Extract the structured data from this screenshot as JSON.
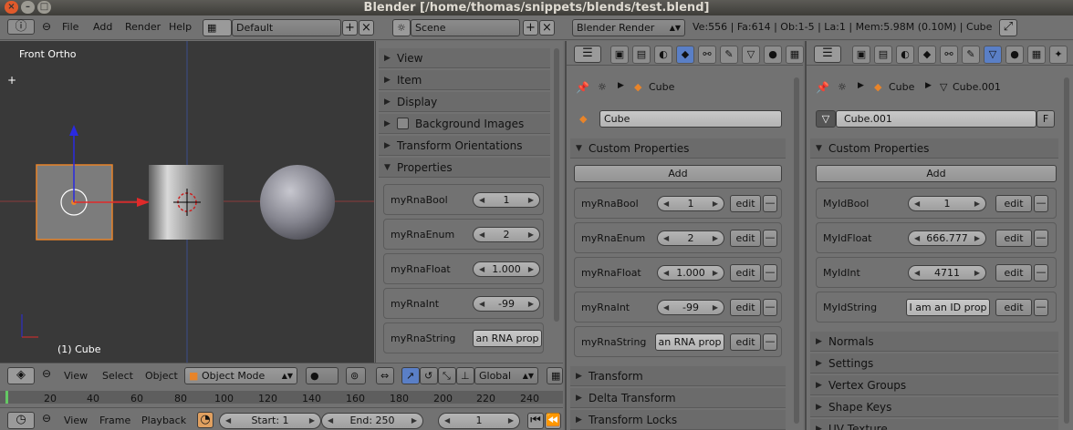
{
  "window": {
    "title": "Blender [/home/thomas/snippets/blends/test.blend]"
  },
  "info_header": {
    "menus": [
      "File",
      "Add",
      "Render",
      "Help"
    ],
    "screen_layout": "Default",
    "scene": "Scene",
    "render_engine": "Blender Render",
    "stats": "Ve:556 | Fa:614 | Ob:1-5 | La:1 | Mem:5.98M (0.10M) | Cube"
  },
  "viewport": {
    "view_label": "Front Ortho",
    "object_label": "(1) Cube"
  },
  "side_panel": {
    "sections": [
      "View",
      "Item",
      "Display",
      "Background Images",
      "Transform Orientations",
      "Properties"
    ],
    "properties": [
      {
        "label": "myRnaBool",
        "value": "1"
      },
      {
        "label": "myRnaEnum",
        "value": "2"
      },
      {
        "label": "myRnaFloat",
        "value": "1.000"
      },
      {
        "label": "myRnaInt",
        "value": "-99"
      },
      {
        "label": "myRnaString",
        "value": "an RNA prop"
      }
    ]
  },
  "object_props": {
    "breadcrumb": "Cube",
    "name_field": "Cube",
    "section": "Custom Properties",
    "add_label": "Add",
    "edit_label": "edit",
    "remove_label": "—",
    "rows": [
      {
        "label": "myRnaBool",
        "value": "1"
      },
      {
        "label": "myRnaEnum",
        "value": "2"
      },
      {
        "label": "myRnaFloat",
        "value": "1.000"
      },
      {
        "label": "myRnaInt",
        "value": "-99"
      },
      {
        "label": "myRnaString",
        "value": "an RNA prop"
      }
    ],
    "collapsed": [
      "Transform",
      "Delta Transform",
      "Transform Locks"
    ]
  },
  "mesh_props": {
    "breadcrumb_object": "Cube",
    "breadcrumb_mesh": "Cube.001",
    "name_field": "Cube.001",
    "fake_user": "F",
    "section": "Custom Properties",
    "add_label": "Add",
    "edit_label": "edit",
    "remove_label": "—",
    "rows": [
      {
        "label": "MyIdBool",
        "value": "1"
      },
      {
        "label": "MyIdFloat",
        "value": "666.777"
      },
      {
        "label": "MyIdInt",
        "value": "4711"
      },
      {
        "label": "MyIdString",
        "value": "I am an ID prop"
      }
    ],
    "collapsed": [
      "Normals",
      "Settings",
      "Vertex Groups",
      "Shape Keys",
      "UV Texture"
    ]
  },
  "view3d_header": {
    "menus": [
      "View",
      "Select",
      "Object"
    ],
    "mode": "Object Mode",
    "orientation": "Global"
  },
  "timeline": {
    "ticks": [
      "20",
      "40",
      "60",
      "80",
      "100",
      "120",
      "140",
      "160",
      "180",
      "200",
      "220",
      "240"
    ],
    "menus": [
      "View",
      "Frame",
      "Playback"
    ],
    "start": "Start: 1",
    "end": "End: 250",
    "current": "1"
  },
  "colors": {
    "background": "#727272",
    "viewport": "#393939",
    "selection_orange": "#e8842a",
    "active_tab": "#5a7fc6"
  }
}
